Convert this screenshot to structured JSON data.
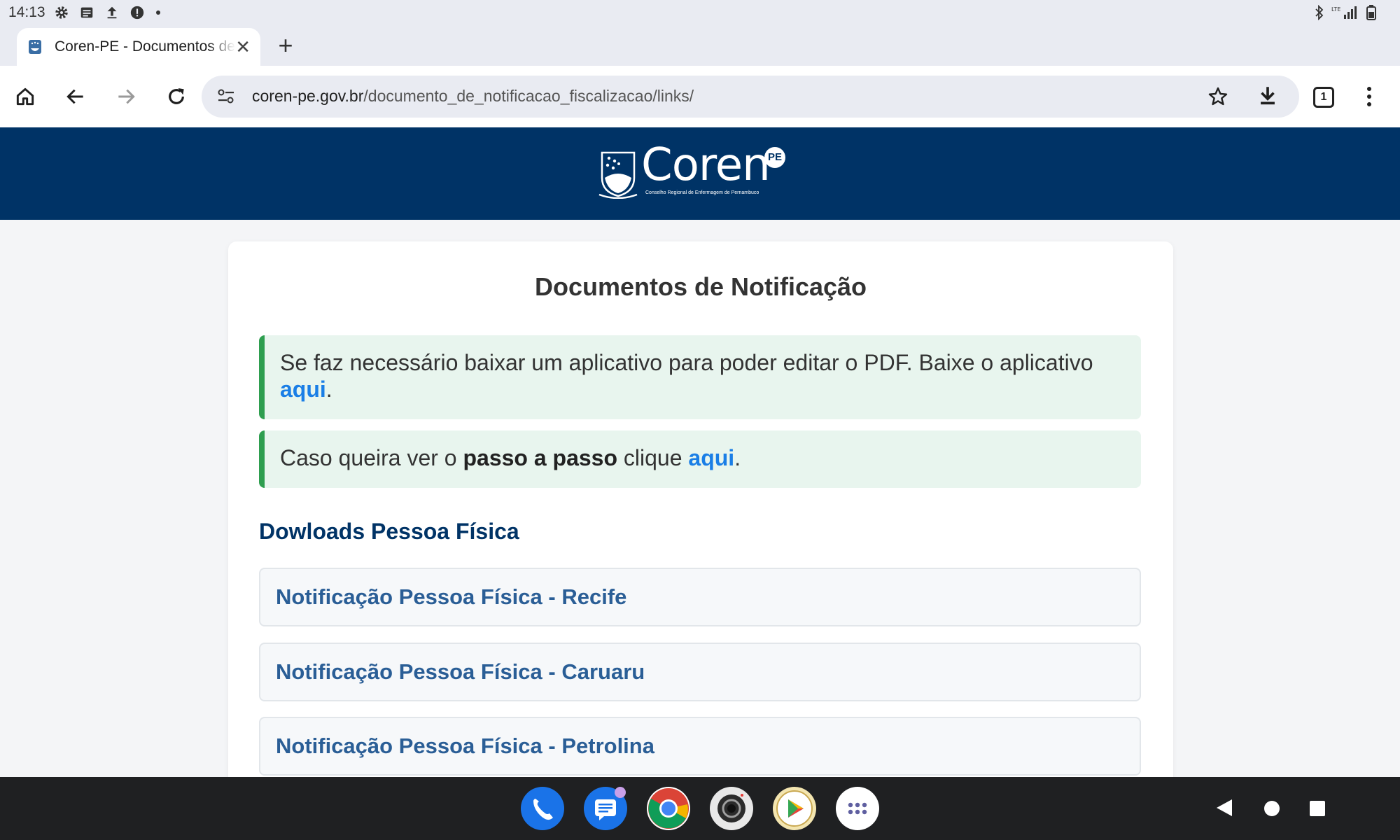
{
  "statusbar": {
    "time": "14:13",
    "network": "LTE"
  },
  "browser": {
    "tab_title": "Coren-PE - Documentos de Notificação",
    "tab_count": "1",
    "url_host": "coren-pe.gov.br",
    "url_path": "/documento_de_notificacao_fiscalizacao/links/"
  },
  "site": {
    "brand": "Coren",
    "brand_badge": "PE",
    "brand_subtitle": "Conselho Regional de Enfermagem de Pernambuco",
    "header_color": "#003366"
  },
  "page": {
    "title": "Documentos de Notificação",
    "alert1": {
      "text": "Se faz necessário baixar um aplicativo para poder editar o PDF. Baixe o aplicativo ",
      "link": "aqui",
      "after": "."
    },
    "alert2": {
      "before": "Caso queira ver o ",
      "bold": "passo a passo",
      "middle": " clique ",
      "link": "aqui",
      "after": "."
    },
    "section_title": "Dowloads Pessoa Física",
    "downloads": [
      "Notificação Pessoa Física - Recife",
      "Notificação Pessoa Física - Caruaru",
      "Notificação Pessoa Física - Petrolina"
    ]
  },
  "icons": {
    "status": [
      "gear-icon",
      "notes-icon",
      "upload-icon",
      "alert-icon",
      "dot-icon",
      "bluetooth-icon",
      "signal-icon",
      "battery-icon"
    ],
    "dock": [
      "phone-app-icon",
      "messages-app-icon",
      "chrome-app-icon",
      "camera-app-icon",
      "play-store-app-icon",
      "app-drawer-icon"
    ]
  }
}
